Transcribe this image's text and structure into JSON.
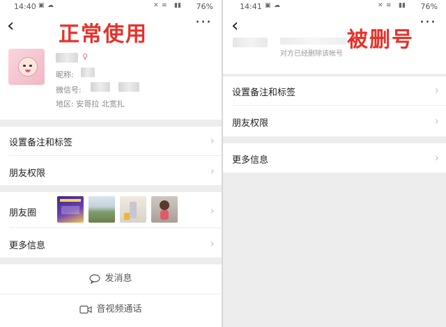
{
  "left": {
    "status": {
      "time": "14:40",
      "battery": "76%"
    },
    "overlay": "正常使用",
    "profile": {
      "nickname_label": "昵称:",
      "wechat_id_label": "微信号:",
      "region": "地区: 安哥拉 北宽扎"
    },
    "rows": {
      "remark_tags": "设置备注和标签",
      "friend_permissions": "朋友权限",
      "moments": "朋友圈",
      "more_info": "更多信息"
    },
    "actions": {
      "send_message": "发消息",
      "video_call": "音视频通话"
    }
  },
  "right": {
    "status": {
      "time": "14:41",
      "battery": "76%"
    },
    "overlay": "被删号",
    "deleted_notice": "对方已经删除该帐号",
    "rows": {
      "remark_tags": "设置备注和标签",
      "friend_permissions": "朋友权限",
      "more_info": "更多信息"
    }
  },
  "colors": {
    "overlay": "#e8302a",
    "gray_bg": "#ededed",
    "text": "#222222"
  },
  "icons": [
    "back-icon",
    "more-icon",
    "chevron-right-icon",
    "chat-bubble-icon",
    "video-camera-icon",
    "wifi-icon",
    "signal-icon",
    "image-icon",
    "cloud-icon",
    "mute-icon"
  ]
}
